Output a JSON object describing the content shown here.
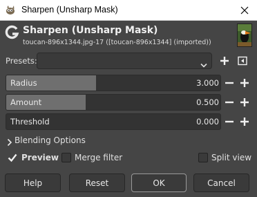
{
  "window": {
    "title": "Sharpen (Unsharp Mask)",
    "close_icon": "close-icon",
    "app_icon": "gimp-wilber-icon"
  },
  "header": {
    "title": "Sharpen (Unsharp Mask)",
    "subtitle": "toucan-896x1344.jpg-17 ([toucan-896x1344] (imported))",
    "logo_icon": "gegl-g-icon",
    "thumbnail": "toucan-thumbnail"
  },
  "presets": {
    "label": "Presets:",
    "value": "",
    "dropdown_icon": "chevron-down-icon",
    "add_icon": "plus-icon",
    "menu_icon": "collapse-left-icon"
  },
  "sliders": [
    {
      "label": "Radius",
      "value": "3.000",
      "fraction": 0.42
    },
    {
      "label": "Amount",
      "value": "0.500",
      "fraction": 0.37
    },
    {
      "label": "Threshold",
      "value": "0.000",
      "fraction": 0.0
    }
  ],
  "blending": {
    "label": "Blending Options",
    "expanded": false
  },
  "options": {
    "preview": {
      "label": "Preview",
      "checked": true
    },
    "merge_filter": {
      "label": "Merge filter",
      "checked": false
    },
    "split_view": {
      "label": "Split view",
      "checked": false
    }
  },
  "buttons": {
    "help": "Help",
    "reset": "Reset",
    "ok": "OK",
    "cancel": "Cancel"
  },
  "colors": {
    "background": "#454545",
    "slider_fill": "#6f6f6f",
    "check_accent": "#4a90d9"
  }
}
